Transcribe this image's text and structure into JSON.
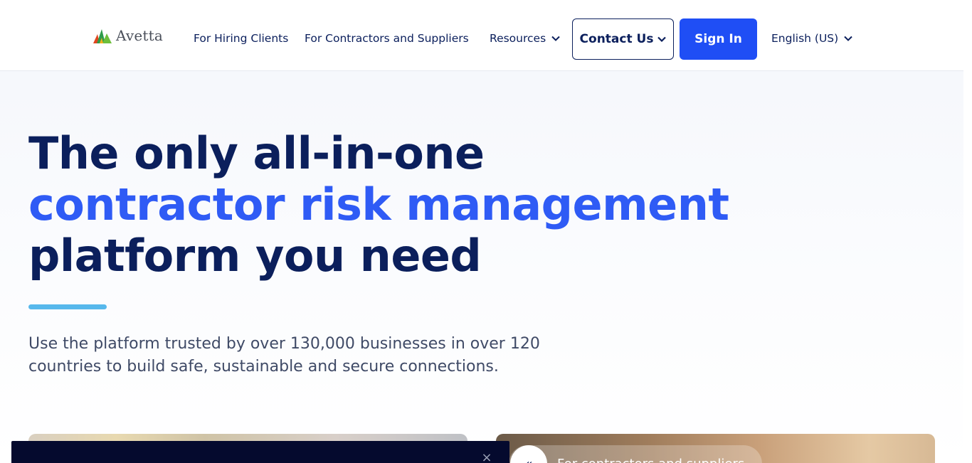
{
  "brand": {
    "name": "Avetta",
    "logo_icon": "avetta-mountain-logo",
    "colors": {
      "navy": "#0b1f5c",
      "accent_blue": "#2f5bf5",
      "button_blue": "#1f4ef5",
      "underline": "#57b8ec"
    }
  },
  "nav": {
    "hiring_clients": "For Hiring Clients",
    "contractors": "For Contractors and Suppliers",
    "resources": "Resources",
    "contact": "Contact Us",
    "sign_in": "Sign In",
    "language": "English (US)"
  },
  "hero": {
    "title_line1": "The only all-in-one",
    "title_line2": "contractor risk management",
    "title_line3": "platform you need",
    "subtitle": "Use the platform trusted by over 130,000 businesses in over 120 countries to build safe, sustainable and secure connections."
  },
  "cards": {
    "right_label": "For contractors and suppliers",
    "right_arrow": "«"
  },
  "banner": {
    "close_glyph": "×"
  }
}
